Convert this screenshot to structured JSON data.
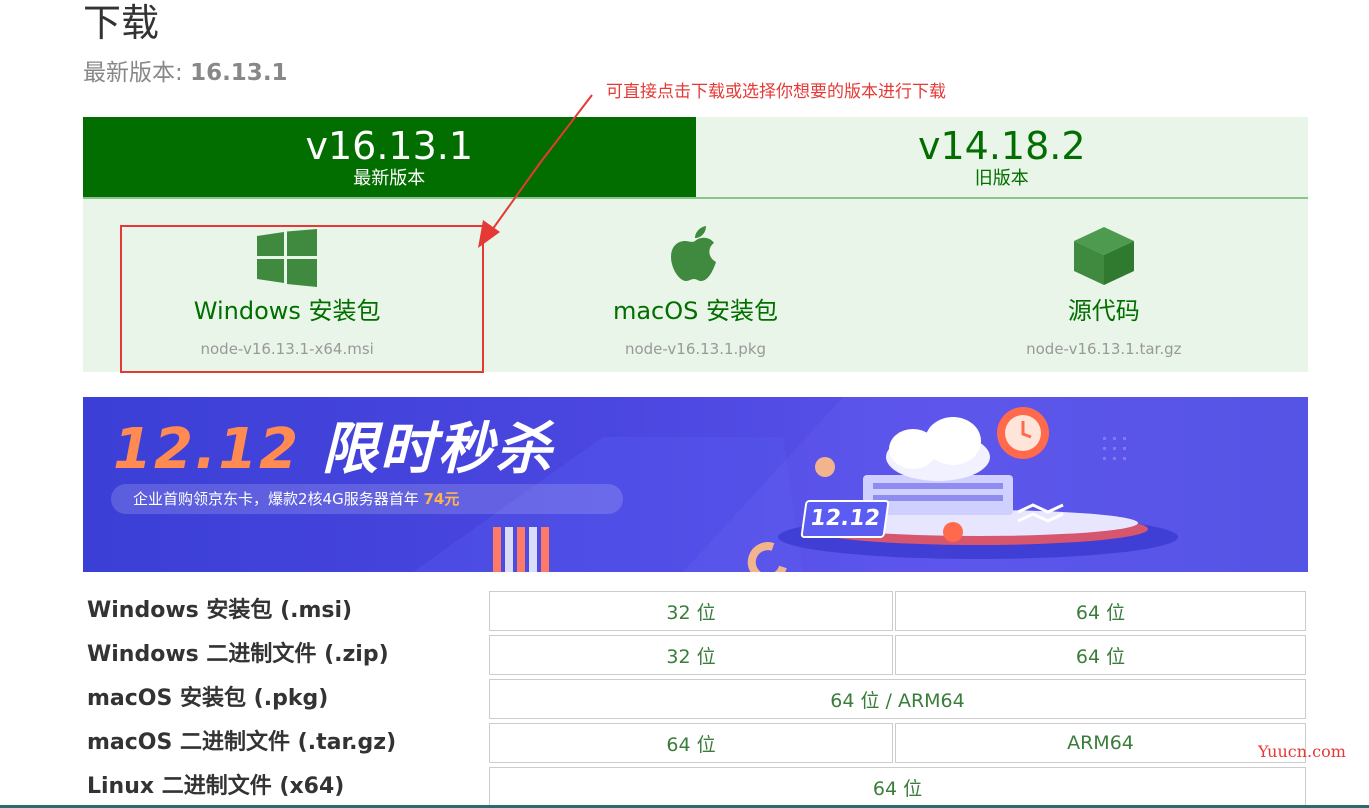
{
  "page": {
    "title": "下载",
    "latest_label": "最新版本:",
    "latest_version": "16.13.1"
  },
  "annotation": {
    "text": "可直接点击下载或选择你想要的版本进行下载",
    "color": "#e53935"
  },
  "tabs": [
    {
      "version": "v16.13.1",
      "label": "最新版本",
      "active": true
    },
    {
      "version": "v14.18.2",
      "label": "旧版本",
      "active": false
    }
  ],
  "downloads": [
    {
      "icon": "windows-icon",
      "name": "Windows 安装包",
      "file": "node-v16.13.1-x64.msi"
    },
    {
      "icon": "apple-icon",
      "name": "macOS 安装包",
      "file": "node-v16.13.1.pkg"
    },
    {
      "icon": "cube-icon",
      "name": "源代码",
      "file": "node-v16.13.1.tar.gz"
    }
  ],
  "banner": {
    "title_num": "12.12",
    "title_text": "限时秒杀",
    "subtitle": "企业首购领京东卡，爆款2核4G服务器首年",
    "price": "74元",
    "badge": "12.12"
  },
  "table": [
    {
      "label": "Windows 安装包 (.msi)",
      "cells": [
        "32 位",
        "64 位"
      ]
    },
    {
      "label": "Windows 二进制文件 (.zip)",
      "cells": [
        "32 位",
        "64 位"
      ]
    },
    {
      "label": "macOS 安装包 (.pkg)",
      "cells": [
        "64 位 / ARM64"
      ]
    },
    {
      "label": "macOS 二进制文件 (.tar.gz)",
      "cells": [
        "64 位",
        "ARM64"
      ]
    },
    {
      "label": "Linux 二进制文件 (x64)",
      "cells": [
        "64 位"
      ]
    }
  ],
  "watermark": "Yuucn.com",
  "colors": {
    "brand_green": "#026e00",
    "light_green_bg": "#e8f5e8",
    "annotation_red": "#e53935"
  }
}
